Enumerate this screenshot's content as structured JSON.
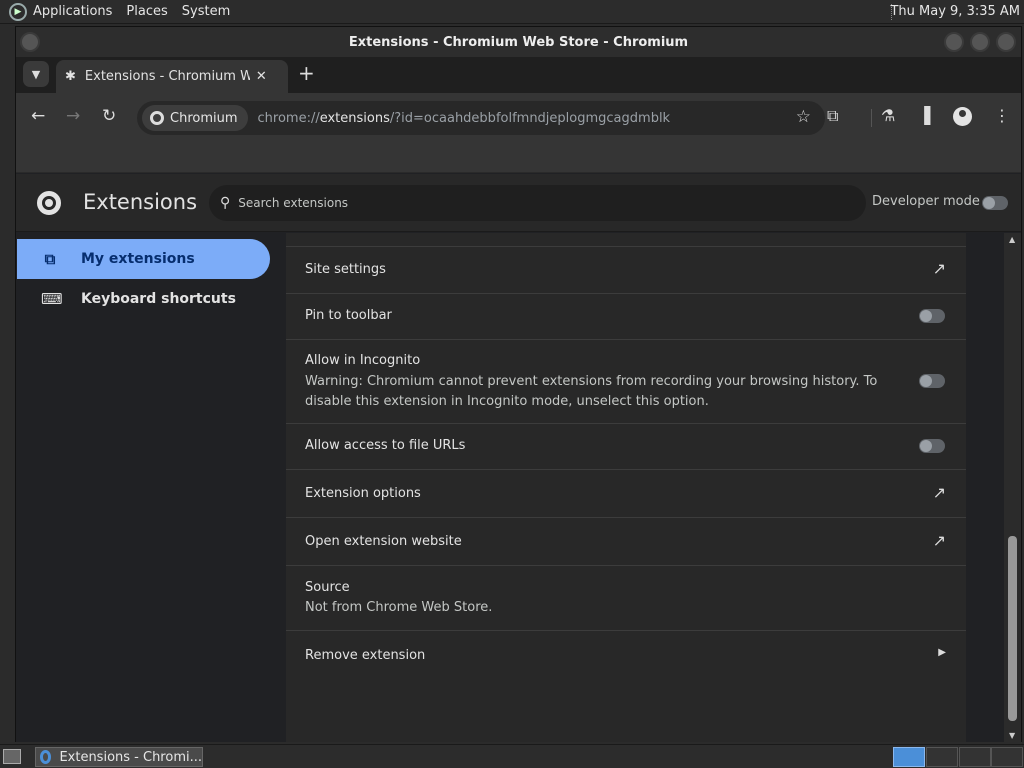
{
  "desktop": {
    "menus": [
      "Applications",
      "Places",
      "System"
    ],
    "clock": "Thu May 9,  3:35 AM"
  },
  "window": {
    "title": "Extensions - Chromium Web Store - Chromium"
  },
  "tab": {
    "label": "Extensions - Chromium Web Store",
    "close": "✕",
    "new_tab": "+"
  },
  "omnibox": {
    "chip_label": "Chromium",
    "url_prefix": "chrome://",
    "url_host": "extensions",
    "url_rest": "/?id=ocaahdebbfolfmndjeplogmgcagdmblk"
  },
  "extensions_page": {
    "title": "Extensions",
    "search_placeholder": "Search extensions",
    "developer_mode_label": "Developer mode",
    "developer_mode_on": false
  },
  "sidebar": {
    "items": [
      {
        "label": "My extensions",
        "active": true
      },
      {
        "label": "Keyboard shortcuts",
        "active": false
      }
    ]
  },
  "details": {
    "site_settings": "Site settings",
    "pin_to_toolbar": "Pin to toolbar",
    "pin_on": false,
    "allow_incognito": "Allow in Incognito",
    "incognito_warning": "Warning: Chromium cannot prevent extensions from recording your browsing history. To disable this extension in Incognito mode, unselect this option.",
    "incognito_on": false,
    "allow_file_urls": "Allow access to file URLs",
    "file_urls_on": false,
    "extension_options": "Extension options",
    "open_website": "Open extension website",
    "source_label": "Source",
    "source_value": "Not from Chrome Web Store.",
    "remove": "Remove extension"
  },
  "taskbar": {
    "task_label": "Extensions - Chromi..."
  }
}
